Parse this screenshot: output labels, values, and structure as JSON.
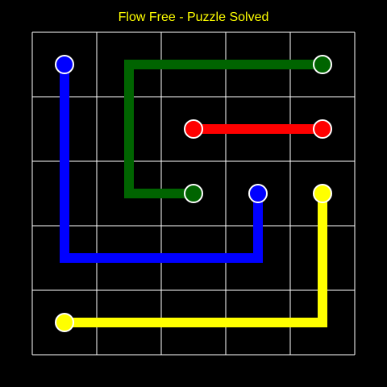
{
  "title": "Flow Free - Puzzle Solved",
  "board": {
    "rows": 5,
    "cols": 5,
    "grid_color": "#ffffff",
    "background": "#000000"
  },
  "flows": [
    {
      "color_name": "blue",
      "color": "#0000ff",
      "endpoints": [
        [
          0,
          0
        ],
        [
          2,
          3
        ]
      ],
      "path": [
        [
          0,
          0
        ],
        [
          1,
          0
        ],
        [
          2,
          0
        ],
        [
          3,
          0
        ],
        [
          3,
          1
        ],
        [
          3,
          2
        ],
        [
          3,
          3
        ],
        [
          2,
          3
        ]
      ]
    },
    {
      "color_name": "green",
      "color": "#006400",
      "endpoints": [
        [
          0,
          4
        ],
        [
          2,
          2
        ]
      ],
      "path": [
        [
          0,
          4
        ],
        [
          0,
          3
        ],
        [
          0,
          2
        ],
        [
          0,
          1
        ],
        [
          1,
          1
        ],
        [
          2,
          1
        ],
        [
          2,
          2
        ]
      ]
    },
    {
      "color_name": "red",
      "color": "#ff0000",
      "endpoints": [
        [
          1,
          2
        ],
        [
          1,
          4
        ]
      ],
      "path": [
        [
          1,
          2
        ],
        [
          1,
          3
        ],
        [
          1,
          4
        ]
      ]
    },
    {
      "color_name": "yellow",
      "color": "#ffff00",
      "endpoints": [
        [
          4,
          0
        ],
        [
          2,
          4
        ]
      ],
      "path": [
        [
          4,
          0
        ],
        [
          4,
          1
        ],
        [
          4,
          2
        ],
        [
          4,
          3
        ],
        [
          4,
          4
        ],
        [
          3,
          4
        ],
        [
          2,
          4
        ]
      ]
    }
  ]
}
